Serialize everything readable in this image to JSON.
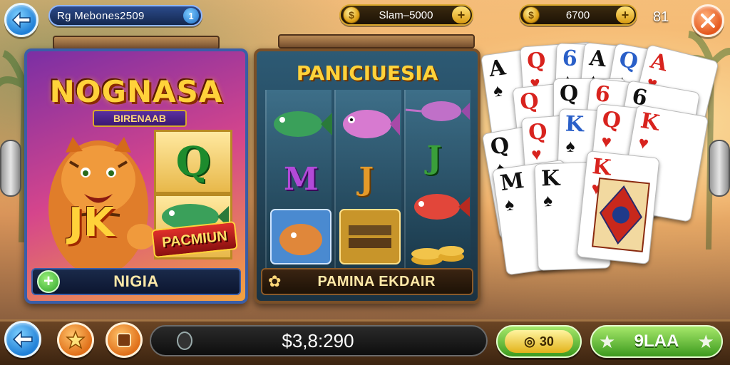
{
  "top_bar": {
    "player_name": "Rg Mebones2509",
    "player_level": "1",
    "currency_1": "Slam–5000",
    "currency_2": "6700",
    "count": "81"
  },
  "game_card_1": {
    "title": "NOGNASA",
    "subtitle": "BIRENAAB",
    "symbol_letters": "JK",
    "symbol_q": "Q",
    "premium_label": "PACMIUN",
    "footer_label": "NIGIA"
  },
  "game_card_2": {
    "title": "PANICIUESIA",
    "reel_letters": [
      "M",
      "J",
      "J"
    ],
    "footer_label": "PAMINA EKDAIR"
  },
  "playing_cards": [
    {
      "rank": "A",
      "suit": "♠",
      "color": "blk"
    },
    {
      "rank": "Q",
      "suit": "♥",
      "color": "red"
    },
    {
      "rank": "6",
      "suit": "♠",
      "color": "blu"
    },
    {
      "rank": "A",
      "suit": "♠",
      "color": "blk"
    },
    {
      "rank": "Q",
      "suit": "♠",
      "color": "blu"
    },
    {
      "rank": "A",
      "suit": "♥",
      "color": "red"
    },
    {
      "rank": "Q",
      "suit": "♥",
      "color": "red"
    },
    {
      "rank": "Q",
      "suit": "♠",
      "color": "blk"
    },
    {
      "rank": "6",
      "suit": "♥",
      "color": "red"
    },
    {
      "rank": "6",
      "suit": "♠",
      "color": "blk"
    },
    {
      "rank": "Q",
      "suit": "♠",
      "color": "blk"
    },
    {
      "rank": "Q",
      "suit": "♥",
      "color": "red"
    },
    {
      "rank": "K",
      "suit": "♠",
      "color": "blu"
    },
    {
      "rank": "Q",
      "suit": "♥",
      "color": "red"
    },
    {
      "rank": "K",
      "suit": "♥",
      "color": "red"
    },
    {
      "rank": "M",
      "suit": "♠",
      "color": "blk"
    },
    {
      "rank": "K",
      "suit": "♠",
      "color": "blk"
    },
    {
      "rank": "K",
      "suit": "♥",
      "color": "red"
    }
  ],
  "bottom_bar": {
    "balance": "$3,8:290",
    "bet_value": "30",
    "spin_label": "9LAA"
  },
  "colors": {
    "accent_gold": "#d9a72c",
    "accent_blue": "#1f7fd6",
    "accent_green": "#3c9a1e",
    "close_orange": "#e5561c"
  }
}
